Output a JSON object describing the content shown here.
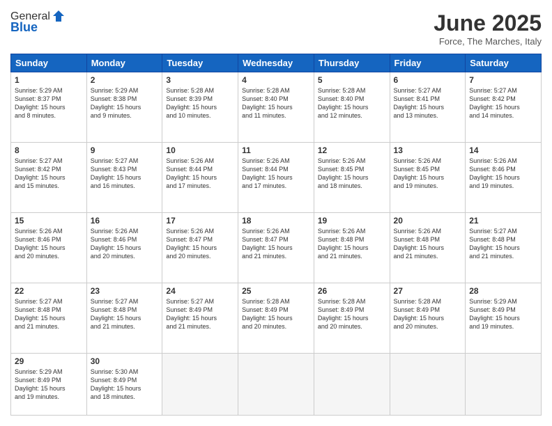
{
  "logo": {
    "general": "General",
    "blue": "Blue"
  },
  "title": "June 2025",
  "location": "Force, The Marches, Italy",
  "days_of_week": [
    "Sunday",
    "Monday",
    "Tuesday",
    "Wednesday",
    "Thursday",
    "Friday",
    "Saturday"
  ],
  "weeks": [
    [
      {
        "day": "1",
        "info": "Sunrise: 5:29 AM\nSunset: 8:37 PM\nDaylight: 15 hours\nand 8 minutes."
      },
      {
        "day": "2",
        "info": "Sunrise: 5:29 AM\nSunset: 8:38 PM\nDaylight: 15 hours\nand 9 minutes."
      },
      {
        "day": "3",
        "info": "Sunrise: 5:28 AM\nSunset: 8:39 PM\nDaylight: 15 hours\nand 10 minutes."
      },
      {
        "day": "4",
        "info": "Sunrise: 5:28 AM\nSunset: 8:40 PM\nDaylight: 15 hours\nand 11 minutes."
      },
      {
        "day": "5",
        "info": "Sunrise: 5:28 AM\nSunset: 8:40 PM\nDaylight: 15 hours\nand 12 minutes."
      },
      {
        "day": "6",
        "info": "Sunrise: 5:27 AM\nSunset: 8:41 PM\nDaylight: 15 hours\nand 13 minutes."
      },
      {
        "day": "7",
        "info": "Sunrise: 5:27 AM\nSunset: 8:42 PM\nDaylight: 15 hours\nand 14 minutes."
      }
    ],
    [
      {
        "day": "8",
        "info": "Sunrise: 5:27 AM\nSunset: 8:42 PM\nDaylight: 15 hours\nand 15 minutes."
      },
      {
        "day": "9",
        "info": "Sunrise: 5:27 AM\nSunset: 8:43 PM\nDaylight: 15 hours\nand 16 minutes."
      },
      {
        "day": "10",
        "info": "Sunrise: 5:26 AM\nSunset: 8:44 PM\nDaylight: 15 hours\nand 17 minutes."
      },
      {
        "day": "11",
        "info": "Sunrise: 5:26 AM\nSunset: 8:44 PM\nDaylight: 15 hours\nand 17 minutes."
      },
      {
        "day": "12",
        "info": "Sunrise: 5:26 AM\nSunset: 8:45 PM\nDaylight: 15 hours\nand 18 minutes."
      },
      {
        "day": "13",
        "info": "Sunrise: 5:26 AM\nSunset: 8:45 PM\nDaylight: 15 hours\nand 19 minutes."
      },
      {
        "day": "14",
        "info": "Sunrise: 5:26 AM\nSunset: 8:46 PM\nDaylight: 15 hours\nand 19 minutes."
      }
    ],
    [
      {
        "day": "15",
        "info": "Sunrise: 5:26 AM\nSunset: 8:46 PM\nDaylight: 15 hours\nand 20 minutes."
      },
      {
        "day": "16",
        "info": "Sunrise: 5:26 AM\nSunset: 8:46 PM\nDaylight: 15 hours\nand 20 minutes."
      },
      {
        "day": "17",
        "info": "Sunrise: 5:26 AM\nSunset: 8:47 PM\nDaylight: 15 hours\nand 20 minutes."
      },
      {
        "day": "18",
        "info": "Sunrise: 5:26 AM\nSunset: 8:47 PM\nDaylight: 15 hours\nand 21 minutes."
      },
      {
        "day": "19",
        "info": "Sunrise: 5:26 AM\nSunset: 8:48 PM\nDaylight: 15 hours\nand 21 minutes."
      },
      {
        "day": "20",
        "info": "Sunrise: 5:26 AM\nSunset: 8:48 PM\nDaylight: 15 hours\nand 21 minutes."
      },
      {
        "day": "21",
        "info": "Sunrise: 5:27 AM\nSunset: 8:48 PM\nDaylight: 15 hours\nand 21 minutes."
      }
    ],
    [
      {
        "day": "22",
        "info": "Sunrise: 5:27 AM\nSunset: 8:48 PM\nDaylight: 15 hours\nand 21 minutes."
      },
      {
        "day": "23",
        "info": "Sunrise: 5:27 AM\nSunset: 8:48 PM\nDaylight: 15 hours\nand 21 minutes."
      },
      {
        "day": "24",
        "info": "Sunrise: 5:27 AM\nSunset: 8:49 PM\nDaylight: 15 hours\nand 21 minutes."
      },
      {
        "day": "25",
        "info": "Sunrise: 5:28 AM\nSunset: 8:49 PM\nDaylight: 15 hours\nand 20 minutes."
      },
      {
        "day": "26",
        "info": "Sunrise: 5:28 AM\nSunset: 8:49 PM\nDaylight: 15 hours\nand 20 minutes."
      },
      {
        "day": "27",
        "info": "Sunrise: 5:28 AM\nSunset: 8:49 PM\nDaylight: 15 hours\nand 20 minutes."
      },
      {
        "day": "28",
        "info": "Sunrise: 5:29 AM\nSunset: 8:49 PM\nDaylight: 15 hours\nand 19 minutes."
      }
    ],
    [
      {
        "day": "29",
        "info": "Sunrise: 5:29 AM\nSunset: 8:49 PM\nDaylight: 15 hours\nand 19 minutes."
      },
      {
        "day": "30",
        "info": "Sunrise: 5:30 AM\nSunset: 8:49 PM\nDaylight: 15 hours\nand 18 minutes."
      },
      {
        "day": "",
        "info": ""
      },
      {
        "day": "",
        "info": ""
      },
      {
        "day": "",
        "info": ""
      },
      {
        "day": "",
        "info": ""
      },
      {
        "day": "",
        "info": ""
      }
    ]
  ]
}
